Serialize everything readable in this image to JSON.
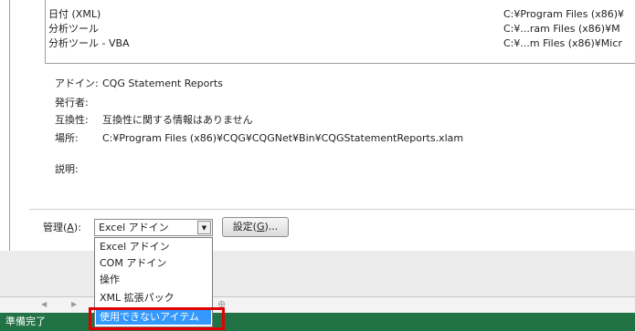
{
  "addin_list": [
    {
      "name": "日付 (XML)",
      "path": "C:¥Program Files (x86)¥"
    },
    {
      "name": "分析ツール",
      "path": "C:¥...ram Files (x86)¥M"
    },
    {
      "name": "分析ツール - VBA",
      "path": "C:¥...m Files (x86)¥Micr"
    }
  ],
  "details": {
    "addin_label": "アドイン:",
    "addin_value": "CQG Statement Reports",
    "publisher_label": "発行者:",
    "compat_label": "互換性:",
    "compat_value": "互換性に関する情報はありません",
    "location_label": "場所:",
    "location_value": "C:¥Program Files (x86)¥CQG¥CQGNet¥Bin¥CQGStatementReports.xlam",
    "description_label": "説明:"
  },
  "manage": {
    "label_prefix": "管理(",
    "label_key": "A",
    "label_suffix": "):",
    "selected": "Excel アドイン",
    "go_prefix": "設定(",
    "go_key": "G",
    "go_suffix": ")..."
  },
  "dropdown_options": [
    "Excel アドイン",
    "COM アドイン",
    "操作",
    "XML 拡張パック",
    "使用できないアイテム"
  ],
  "highlighted_option_index": 4,
  "status_bar": {
    "text": "準備完了",
    "color": "#217346"
  },
  "colors": {
    "highlight": "#3399ff",
    "annotation_box": "#e00000"
  }
}
